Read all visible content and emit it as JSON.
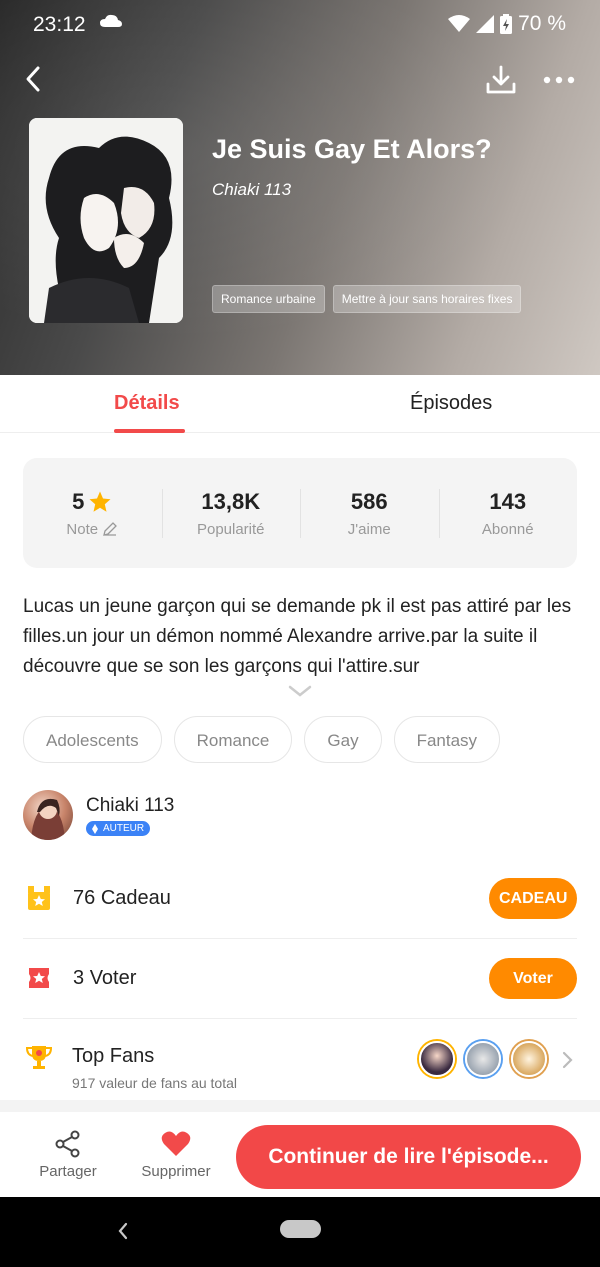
{
  "status_bar": {
    "time": "23:12",
    "battery": "70 %"
  },
  "header": {
    "title": "Je Suis Gay Et Alors?",
    "author": "Chiaki 113",
    "tags": [
      "Romance urbaine",
      "Mettre à jour sans horaires fixes"
    ]
  },
  "tabs": {
    "details": "Détails",
    "episodes": "Épisodes"
  },
  "stats": [
    {
      "value": "5",
      "label": "Note"
    },
    {
      "value": "13,8K",
      "label": "Popularité"
    },
    {
      "value": "586",
      "label": "J'aime"
    },
    {
      "value": "143",
      "label": "Abonné"
    }
  ],
  "description": "Lucas un jeune garçon qui se demande pk il est pas attiré par les filles.un jour un démon nommé Alexandre arrive.par la suite il découvre que se son les garçons qui l'attire.sur",
  "genres": [
    "Adolescents",
    "Romance",
    "Gay",
    "Fantasy"
  ],
  "author": {
    "name": "Chiaki 113",
    "badge": "AUTEUR"
  },
  "gift": {
    "count": "76",
    "label": "Cadeau",
    "button": "CADEAU"
  },
  "vote": {
    "count": "3",
    "label": "Voter",
    "button": "Voter"
  },
  "top_fans": {
    "title": "Top Fans",
    "subtitle": "917 valeur de fans au total"
  },
  "bottom_bar": {
    "share": "Partager",
    "delete": "Supprimer",
    "continue": "Continuer de lire l'épisode..."
  },
  "colors": {
    "accent": "#f24a4a",
    "orange": "#ff8a00",
    "badge_blue": "#3b82f6"
  }
}
